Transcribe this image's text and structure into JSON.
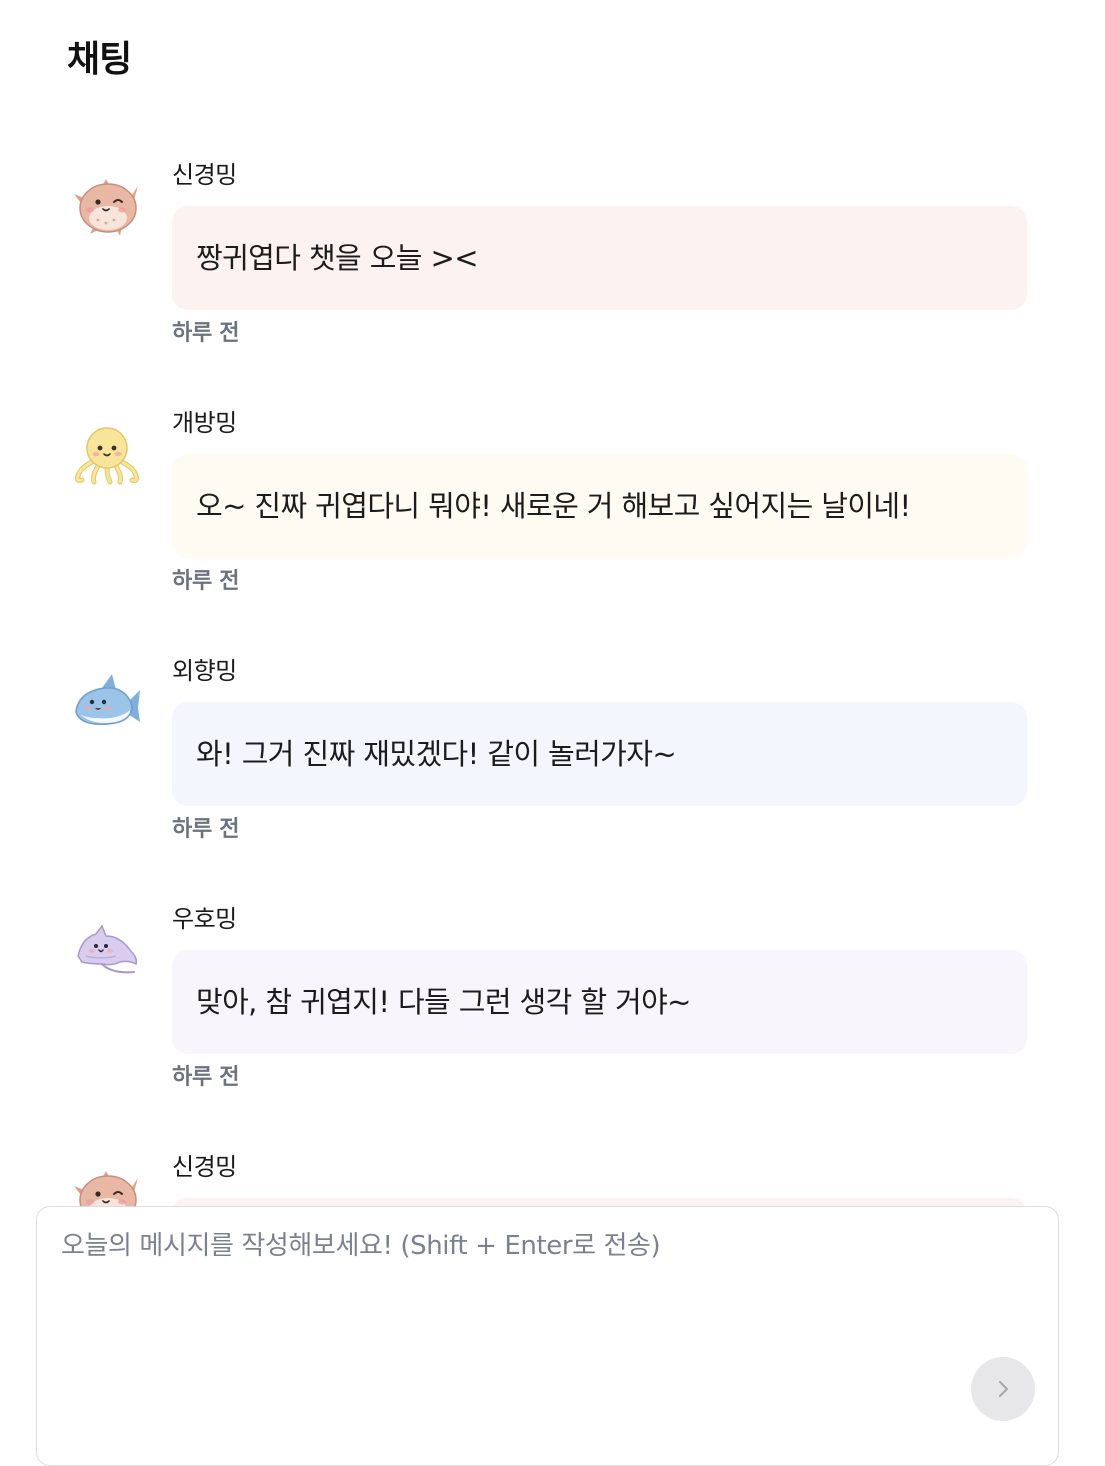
{
  "page": {
    "title": "채팅"
  },
  "messages": [
    {
      "sender": "신경밍",
      "text": "짱귀엽다 챗을 오늘 ><",
      "time": "하루 전",
      "bubble_color": "#fcf2f0",
      "avatar": "pufferfish-avatar"
    },
    {
      "sender": "개방밍",
      "text": "오~ 진짜 귀엽다니 뭐야! 새로운 거 해보고 싶어지는 날이네!",
      "time": "하루 전",
      "bubble_color": "#fefbf2",
      "avatar": "octopus-avatar"
    },
    {
      "sender": "외향밍",
      "text": "와! 그거 진짜 재밌겠다! 같이 놀러가자~",
      "time": "하루 전",
      "bubble_color": "#f3f7fd",
      "avatar": "shark-avatar"
    },
    {
      "sender": "우호밍",
      "text": "맞아, 참 귀엽지! 다들 그런 생각 할 거야~",
      "time": "하루 전",
      "bubble_color": "#f8f5fc",
      "avatar": "stingray-avatar"
    },
    {
      "sender": "신경밍",
      "text": "",
      "time": "",
      "bubble_color": "#fcf2f0",
      "avatar": "pufferfish-avatar"
    }
  ],
  "composer": {
    "placeholder": "오늘의 메시지를 작성해보세요! (Shift + Enter로 전송)",
    "value": "",
    "send_icon": "chevron-right-icon",
    "send_button_color": "#e7e7e9"
  }
}
